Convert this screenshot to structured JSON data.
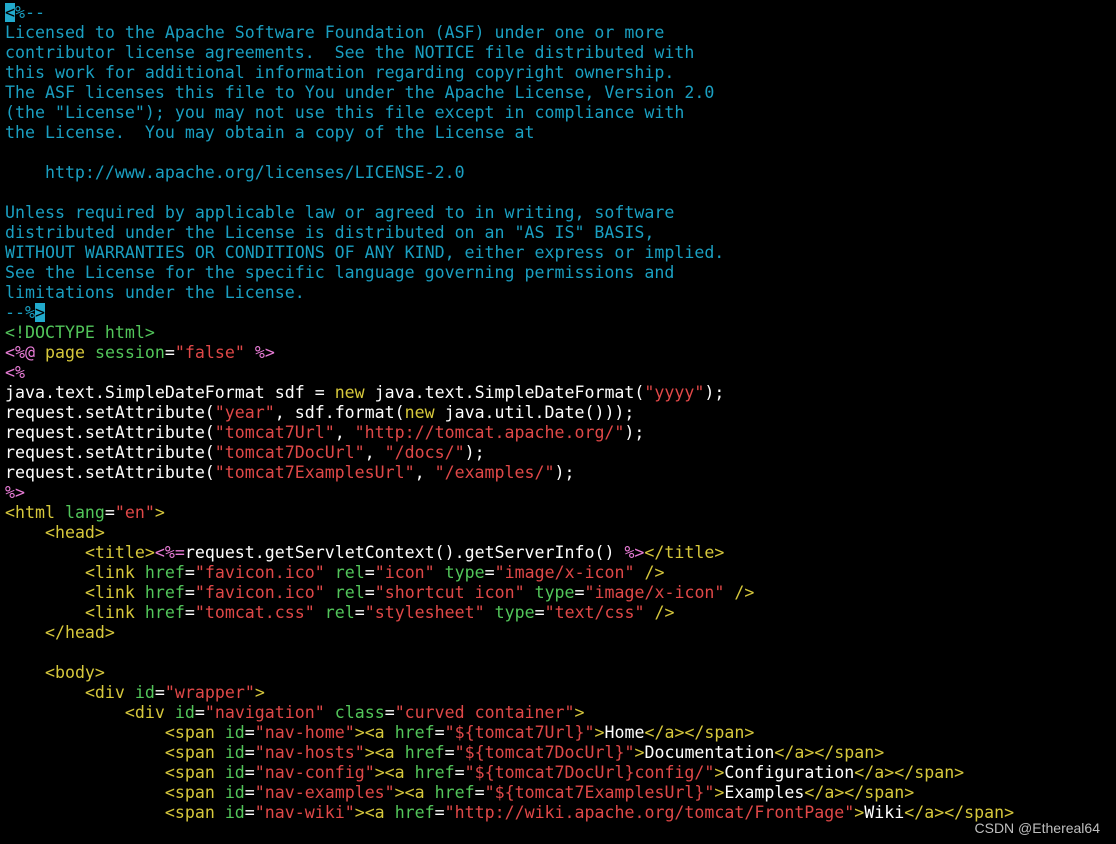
{
  "colors": {
    "c": "#1a9fc1",
    "t": "#ffffff",
    "g": "#52c55a",
    "p": "#e87cd6",
    "r": "#e04848",
    "y": "#d7c83c",
    "x": "#22aacc"
  },
  "lines": [
    [
      [
        "x",
        "<"
      ],
      [
        "c",
        "%--"
      ]
    ],
    [
      [
        "c",
        "Licensed to the Apache Software Foundation (ASF) under one or more"
      ]
    ],
    [
      [
        "c",
        "contributor license agreements.  See the NOTICE file distributed with"
      ]
    ],
    [
      [
        "c",
        "this work for additional information regarding copyright ownership."
      ]
    ],
    [
      [
        "c",
        "The ASF licenses this file to You under the Apache License, Version 2.0"
      ]
    ],
    [
      [
        "c",
        "(the \"License\"); you may not use this file except in compliance with"
      ]
    ],
    [
      [
        "c",
        "the License.  You may obtain a copy of the License at"
      ]
    ],
    [],
    [
      [
        "c",
        "    http://www.apache.org/licenses/LICENSE-2.0"
      ]
    ],
    [],
    [
      [
        "c",
        "Unless required by applicable law or agreed to in writing, software"
      ]
    ],
    [
      [
        "c",
        "distributed under the License is distributed on an \"AS IS\" BASIS,"
      ]
    ],
    [
      [
        "c",
        "WITHOUT WARRANTIES OR CONDITIONS OF ANY KIND, either express or implied."
      ]
    ],
    [
      [
        "c",
        "See the License for the specific language governing permissions and"
      ]
    ],
    [
      [
        "c",
        "limitations under the License."
      ]
    ],
    [
      [
        "c",
        "--%"
      ],
      [
        "x",
        ">"
      ]
    ],
    [
      [
        "g",
        "<!DOCTYPE html>"
      ]
    ],
    [
      [
        "p",
        "<%@"
      ],
      [
        "t",
        " "
      ],
      [
        "y",
        "page"
      ],
      [
        "t",
        " "
      ],
      [
        "g",
        "session"
      ],
      [
        "t",
        "="
      ],
      [
        "r",
        "\"false\""
      ],
      [
        "t",
        " "
      ],
      [
        "p",
        "%>"
      ]
    ],
    [
      [
        "p",
        "<%"
      ]
    ],
    [
      [
        "t",
        "java.text.SimpleDateFormat sdf = "
      ],
      [
        "y",
        "new"
      ],
      [
        "t",
        " java.text.SimpleDateFormat("
      ],
      [
        "r",
        "\"yyyy\""
      ],
      [
        "t",
        ");"
      ]
    ],
    [
      [
        "t",
        "request.setAttribute("
      ],
      [
        "r",
        "\"year\""
      ],
      [
        "t",
        ", sdf.format("
      ],
      [
        "y",
        "new"
      ],
      [
        "t",
        " java.util.Date()));"
      ]
    ],
    [
      [
        "t",
        "request.setAttribute("
      ],
      [
        "r",
        "\"tomcat7Url\""
      ],
      [
        "t",
        ", "
      ],
      [
        "r",
        "\"http://tomcat.apache.org/\""
      ],
      [
        "t",
        ");"
      ]
    ],
    [
      [
        "t",
        "request.setAttribute("
      ],
      [
        "r",
        "\"tomcat7DocUrl\""
      ],
      [
        "t",
        ", "
      ],
      [
        "r",
        "\"/docs/\""
      ],
      [
        "t",
        ");"
      ]
    ],
    [
      [
        "t",
        "request.setAttribute("
      ],
      [
        "r",
        "\"tomcat7ExamplesUrl\""
      ],
      [
        "t",
        ", "
      ],
      [
        "r",
        "\"/examples/\""
      ],
      [
        "t",
        ");"
      ]
    ],
    [
      [
        "p",
        "%>"
      ]
    ],
    [
      [
        "y",
        "<html"
      ],
      [
        "t",
        " "
      ],
      [
        "g",
        "lang"
      ],
      [
        "t",
        "="
      ],
      [
        "r",
        "\"en\""
      ],
      [
        "y",
        ">"
      ]
    ],
    [
      [
        "t",
        "    "
      ],
      [
        "y",
        "<head>"
      ]
    ],
    [
      [
        "t",
        "        "
      ],
      [
        "y",
        "<title>"
      ],
      [
        "p",
        "<%="
      ],
      [
        "t",
        "request.getServletContext().getServerInfo() "
      ],
      [
        "p",
        "%>"
      ],
      [
        "y",
        "</title>"
      ]
    ],
    [
      [
        "t",
        "        "
      ],
      [
        "y",
        "<link"
      ],
      [
        "t",
        " "
      ],
      [
        "g",
        "href"
      ],
      [
        "t",
        "="
      ],
      [
        "r",
        "\"favicon.ico\""
      ],
      [
        "t",
        " "
      ],
      [
        "g",
        "rel"
      ],
      [
        "t",
        "="
      ],
      [
        "r",
        "\"icon\""
      ],
      [
        "t",
        " "
      ],
      [
        "g",
        "type"
      ],
      [
        "t",
        "="
      ],
      [
        "r",
        "\"image/x-icon\""
      ],
      [
        "t",
        " "
      ],
      [
        "y",
        "/>"
      ]
    ],
    [
      [
        "t",
        "        "
      ],
      [
        "y",
        "<link"
      ],
      [
        "t",
        " "
      ],
      [
        "g",
        "href"
      ],
      [
        "t",
        "="
      ],
      [
        "r",
        "\"favicon.ico\""
      ],
      [
        "t",
        " "
      ],
      [
        "g",
        "rel"
      ],
      [
        "t",
        "="
      ],
      [
        "r",
        "\"shortcut icon\""
      ],
      [
        "t",
        " "
      ],
      [
        "g",
        "type"
      ],
      [
        "t",
        "="
      ],
      [
        "r",
        "\"image/x-icon\""
      ],
      [
        "t",
        " "
      ],
      [
        "y",
        "/>"
      ]
    ],
    [
      [
        "t",
        "        "
      ],
      [
        "y",
        "<link"
      ],
      [
        "t",
        " "
      ],
      [
        "g",
        "href"
      ],
      [
        "t",
        "="
      ],
      [
        "r",
        "\"tomcat.css\""
      ],
      [
        "t",
        " "
      ],
      [
        "g",
        "rel"
      ],
      [
        "t",
        "="
      ],
      [
        "r",
        "\"stylesheet\""
      ],
      [
        "t",
        " "
      ],
      [
        "g",
        "type"
      ],
      [
        "t",
        "="
      ],
      [
        "r",
        "\"text/css\""
      ],
      [
        "t",
        " "
      ],
      [
        "y",
        "/>"
      ]
    ],
    [
      [
        "t",
        "    "
      ],
      [
        "y",
        "</head>"
      ]
    ],
    [],
    [
      [
        "t",
        "    "
      ],
      [
        "y",
        "<body>"
      ]
    ],
    [
      [
        "t",
        "        "
      ],
      [
        "y",
        "<div"
      ],
      [
        "t",
        " "
      ],
      [
        "g",
        "id"
      ],
      [
        "t",
        "="
      ],
      [
        "r",
        "\"wrapper\""
      ],
      [
        "y",
        ">"
      ]
    ],
    [
      [
        "t",
        "            "
      ],
      [
        "y",
        "<div"
      ],
      [
        "t",
        " "
      ],
      [
        "g",
        "id"
      ],
      [
        "t",
        "="
      ],
      [
        "r",
        "\"navigation\""
      ],
      [
        "t",
        " "
      ],
      [
        "g",
        "class"
      ],
      [
        "t",
        "="
      ],
      [
        "r",
        "\"curved container\""
      ],
      [
        "y",
        ">"
      ]
    ],
    [
      [
        "t",
        "                "
      ],
      [
        "y",
        "<span"
      ],
      [
        "t",
        " "
      ],
      [
        "g",
        "id"
      ],
      [
        "t",
        "="
      ],
      [
        "r",
        "\"nav-home\""
      ],
      [
        "y",
        "><a"
      ],
      [
        "t",
        " "
      ],
      [
        "g",
        "href"
      ],
      [
        "t",
        "="
      ],
      [
        "r",
        "\"${tomcat7Url}\""
      ],
      [
        "y",
        ">"
      ],
      [
        "t",
        "Home"
      ],
      [
        "y",
        "</a></span>"
      ]
    ],
    [
      [
        "t",
        "                "
      ],
      [
        "y",
        "<span"
      ],
      [
        "t",
        " "
      ],
      [
        "g",
        "id"
      ],
      [
        "t",
        "="
      ],
      [
        "r",
        "\"nav-hosts\""
      ],
      [
        "y",
        "><a"
      ],
      [
        "t",
        " "
      ],
      [
        "g",
        "href"
      ],
      [
        "t",
        "="
      ],
      [
        "r",
        "\"${tomcat7DocUrl}\""
      ],
      [
        "y",
        ">"
      ],
      [
        "t",
        "Documentation"
      ],
      [
        "y",
        "</a></span>"
      ]
    ],
    [
      [
        "t",
        "                "
      ],
      [
        "y",
        "<span"
      ],
      [
        "t",
        " "
      ],
      [
        "g",
        "id"
      ],
      [
        "t",
        "="
      ],
      [
        "r",
        "\"nav-config\""
      ],
      [
        "y",
        "><a"
      ],
      [
        "t",
        " "
      ],
      [
        "g",
        "href"
      ],
      [
        "t",
        "="
      ],
      [
        "r",
        "\"${tomcat7DocUrl}config/\""
      ],
      [
        "y",
        ">"
      ],
      [
        "t",
        "Configuration"
      ],
      [
        "y",
        "</a></span>"
      ]
    ],
    [
      [
        "t",
        "                "
      ],
      [
        "y",
        "<span"
      ],
      [
        "t",
        " "
      ],
      [
        "g",
        "id"
      ],
      [
        "t",
        "="
      ],
      [
        "r",
        "\"nav-examples\""
      ],
      [
        "y",
        "><a"
      ],
      [
        "t",
        " "
      ],
      [
        "g",
        "href"
      ],
      [
        "t",
        "="
      ],
      [
        "r",
        "\"${tomcat7ExamplesUrl}\""
      ],
      [
        "y",
        ">"
      ],
      [
        "t",
        "Examples"
      ],
      [
        "y",
        "</a></span>"
      ]
    ],
    [
      [
        "t",
        "                "
      ],
      [
        "y",
        "<span"
      ],
      [
        "t",
        " "
      ],
      [
        "g",
        "id"
      ],
      [
        "t",
        "="
      ],
      [
        "r",
        "\"nav-wiki\""
      ],
      [
        "y",
        "><a"
      ],
      [
        "t",
        " "
      ],
      [
        "g",
        "href"
      ],
      [
        "t",
        "="
      ],
      [
        "r",
        "\"http://wiki.apache.org/tomcat/FrontPage\""
      ],
      [
        "y",
        ">"
      ],
      [
        "t",
        "Wiki"
      ],
      [
        "y",
        "</a></span>"
      ]
    ]
  ],
  "watermark": "CSDN @Ethereal64"
}
